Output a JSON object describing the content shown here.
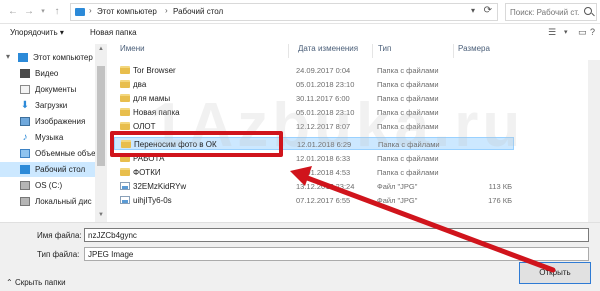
{
  "address_bar": {
    "crumbs": [
      "Этот компьютер",
      "Рабочий стол"
    ],
    "search_placeholder": "Поиск: Рабочий ст..."
  },
  "toolbar": {
    "organize_label": "Упорядочить ▾",
    "new_folder_label": "Новая папка"
  },
  "sidebar": {
    "items": [
      {
        "label": "Этот компьютер",
        "icon": "computer-icon"
      },
      {
        "label": "Видео",
        "icon": "video-icon"
      },
      {
        "label": "Документы",
        "icon": "documents-icon"
      },
      {
        "label": "Загрузки",
        "icon": "downloads-icon"
      },
      {
        "label": "Изображения",
        "icon": "pictures-icon"
      },
      {
        "label": "Музыка",
        "icon": "music-icon"
      },
      {
        "label": "Объемные объе",
        "icon": "3d-objects-icon"
      },
      {
        "label": "Рабочий стол",
        "icon": "desktop-icon",
        "selected": true
      },
      {
        "label": "OS (C:)",
        "icon": "drive-icon"
      },
      {
        "label": "Локальный дис",
        "icon": "drive-icon"
      }
    ]
  },
  "columns": {
    "name": "Имени",
    "date": "Дата изменения",
    "type": "Тип",
    "size": "Размера"
  },
  "files": [
    {
      "name": "Tor Browser",
      "date": "24.09.2017 0:04",
      "type": "Папка с файлами",
      "size": "",
      "kind": "folder"
    },
    {
      "name": "два",
      "date": "05.01.2018 23:10",
      "type": "Папка с файлами",
      "size": "",
      "kind": "folder"
    },
    {
      "name": "для мамы",
      "date": "30.11.2017 6:00",
      "type": "Папка с файлами",
      "size": "",
      "kind": "folder"
    },
    {
      "name": "Новая папка",
      "date": "05.01.2018 23:10",
      "type": "Папка с файлами",
      "size": "",
      "kind": "folder"
    },
    {
      "name": "ОЛОТ",
      "date": "12.12.2017 8:07",
      "type": "Папка с файлами",
      "size": "",
      "kind": "folder"
    },
    {
      "name": "Переносим фото в ОК",
      "date": "12.01.2018 6:29",
      "type": "Папка с файлами",
      "size": "",
      "kind": "folder",
      "highlight": true
    },
    {
      "name": "РАБОТА",
      "date": "12.01.2018 6:33",
      "type": "Папка с файлами",
      "size": "",
      "kind": "folder"
    },
    {
      "name": "ФОТКИ",
      "date": "12.01.2018 4:53",
      "type": "Папка с файлами",
      "size": "",
      "kind": "folder"
    },
    {
      "name": "32EMzKidRYw",
      "date": "13.12.2017 23:24",
      "type": "Файл \"JPG\"",
      "size": "113 КБ",
      "kind": "image"
    },
    {
      "name": "uihjITy6-0s",
      "date": "07.12.2017 6:55",
      "type": "Файл \"JPG\"",
      "size": "176 КБ",
      "kind": "image"
    }
  ],
  "bottom": {
    "filename_label": "Имя файла:",
    "filename_value": "nzJZCb4gync",
    "filetype_label": "Тип файла:",
    "filetype_value": "JPEG Image",
    "hide_folders_label": "Скрыть папки",
    "open_label": "Открыть"
  },
  "watermark": "1Azbuka.ru",
  "colors": {
    "selection": "#cce8ff",
    "annotation_red": "#d0141c",
    "accent_blue": "#2f7bd4"
  }
}
